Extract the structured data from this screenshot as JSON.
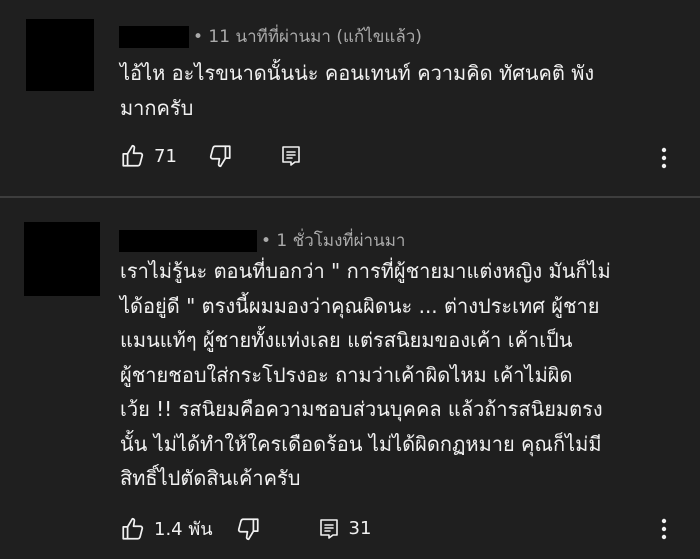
{
  "comments": [
    {
      "meta": "• 11 นาทีที่ผ่านมา (แก้ไขแล้ว)",
      "text": "ไอ้ไห อะไรขนาดนั้นน่ะ คอนเทนท์ ความคิด ทัศนคติ พัง\nมากครับ",
      "likes": "71",
      "replies": ""
    },
    {
      "meta": "• 1 ชั่วโมงที่ผ่านมา",
      "text": "เราไม่รู้นะ ตอนที่บอกว่า \" การที่ผู้ชายมาแต่งหญิง มันก็ไม่\nได้อยู่ดี \" ตรงนี้ผมมองว่าคุณผิดนะ ... ต่างประเทศ ผู้ชาย\nแมนแท้ๆ ผู้ชายทั้งแท่งเลย แต่รสนิยมของเค้า เค้าเป็น\nผู้ชายชอบใส่กระโปรงอะ ถามว่าเค้าผิดไหม เค้าไม่ผิด\nเว้ย !! รสนิยมคือความชอบส่วนบุคคล แล้วถ้ารสนิยมตรง\nนั้น ไม่ได้ทำให้ใครเดือดร้อน ไม่ได้ผิดกฏหมาย คุณก็ไม่มี\nสิทธิ์ไปตัดสินเค้าครับ",
      "likes": "1.4 พัน",
      "replies": "31"
    }
  ],
  "icons": {
    "like": "thumbs-up-icon",
    "dislike": "thumbs-down-icon",
    "reply": "comment-icon",
    "more": "more-vertical-icon"
  },
  "colors": {
    "background": "#1f1f1f",
    "text": "#f1f1f1",
    "meta": "#aaaaaa"
  }
}
